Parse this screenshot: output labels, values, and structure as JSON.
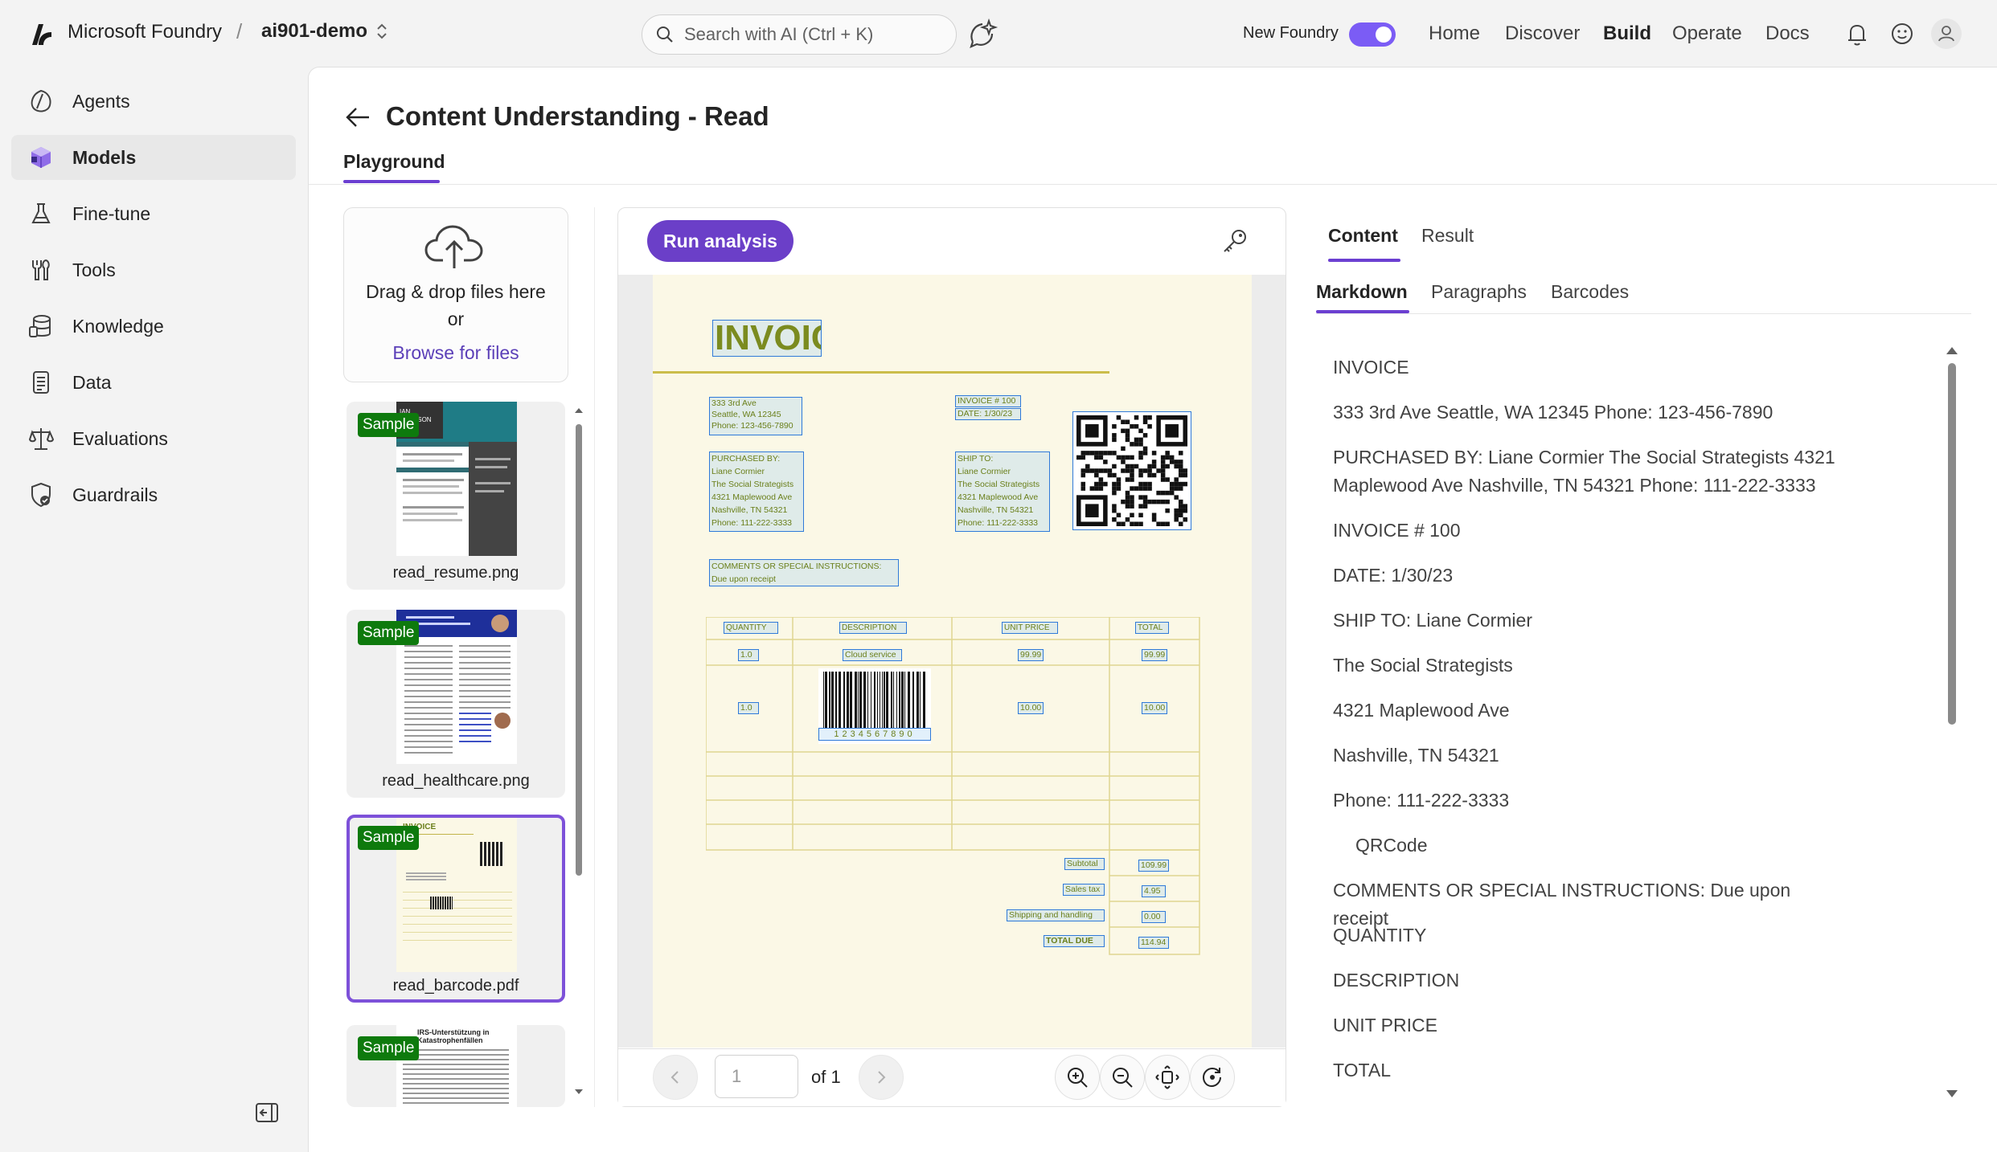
{
  "topbar": {
    "brand": "Microsoft Foundry",
    "separator": "/",
    "project": "ai901-demo",
    "search_placeholder": "Search with AI (Ctrl + K)",
    "new_foundry_label": "New Foundry",
    "nav": [
      "Home",
      "Discover",
      "Build",
      "Operate",
      "Docs"
    ],
    "active_nav": "Build",
    "accent": "#7b5cf5"
  },
  "sidebar": {
    "items": [
      {
        "label": "Agents",
        "icon": "agents-icon"
      },
      {
        "label": "Models",
        "icon": "models-icon",
        "active": true
      },
      {
        "label": "Fine-tune",
        "icon": "flask-icon"
      },
      {
        "label": "Tools",
        "icon": "tools-icon"
      },
      {
        "label": "Knowledge",
        "icon": "database-icon"
      },
      {
        "label": "Data",
        "icon": "document-icon"
      },
      {
        "label": "Evaluations",
        "icon": "scales-icon"
      },
      {
        "label": "Guardrails",
        "icon": "shield-icon"
      }
    ]
  },
  "page": {
    "title": "Content Understanding - Read",
    "tab": "Playground"
  },
  "upload": {
    "line1": "Drag & drop files here",
    "line2": "or",
    "link": "Browse for files"
  },
  "files": {
    "badge": "Sample",
    "items": [
      {
        "name": "read_resume.png",
        "selected": false
      },
      {
        "name": "read_healthcare.png",
        "selected": false
      },
      {
        "name": "read_barcode.pdf",
        "selected": true
      },
      {
        "name": "",
        "selected": false
      }
    ]
  },
  "thumbs": {
    "resume_name": "IAN\nHANSSON",
    "invoice_title": "INVOICE",
    "tax_title": "IRS-Unterstützung in Katastrophenfällen"
  },
  "viewer": {
    "run_button": "Run analysis",
    "page_value": "1",
    "of_label": "of 1"
  },
  "document": {
    "title": "INVOICE",
    "address": [
      "333 3rd Ave",
      "Seattle, WA 12345",
      "Phone: 123-456-7890"
    ],
    "invoice_meta": [
      "INVOICE # 100",
      "DATE: 1/30/23"
    ],
    "purchased_by": [
      "PURCHASED BY:",
      "Liane Cormier",
      "The Social Strategists",
      "4321 Maplewood Ave",
      "Nashville, TN 54321",
      "Phone: 111-222-3333"
    ],
    "ship_to": [
      "SHIP TO:",
      "Liane Cormier",
      "The Social Strategists",
      "4321 Maplewood Ave",
      "Nashville, TN 54321",
      "Phone: 111-222-3333"
    ],
    "comments": [
      "COMMENTS OR SPECIAL INSTRUCTIONS:",
      "Due upon receipt"
    ],
    "table_headers": [
      "QUANTITY",
      "DESCRIPTION",
      "UNIT PRICE",
      "TOTAL"
    ],
    "row1": [
      "1.0",
      "Cloud service",
      "99.99",
      "99.99"
    ],
    "row2": [
      "1.0",
      "",
      "10.00",
      "10.00"
    ],
    "barcode_digits": "1234567890",
    "totals_labels": [
      "Subtotal",
      "Sales tax",
      "Shipping and handling",
      "TOTAL DUE"
    ],
    "totals_values": [
      "109.99",
      "4.95",
      "0.00",
      "114.94"
    ]
  },
  "results": {
    "tabs": [
      "Content",
      "Result"
    ],
    "active_tab": "Content",
    "subtabs": [
      "Markdown",
      "Paragraphs",
      "Barcodes"
    ],
    "active_subtab": "Markdown",
    "markdown_lines": [
      "INVOICE",
      "333 3rd Ave Seattle, WA 12345 Phone: 123-456-7890",
      "PURCHASED BY: Liane Cormier The Social Strategists 4321 Maplewood Ave Nashville, TN 54321 Phone: 111-222-3333",
      "INVOICE # 100",
      "DATE: 1/30/23",
      "SHIP TO: Liane Cormier",
      "The Social Strategists",
      "4321 Maplewood Ave",
      "Nashville, TN 54321",
      "Phone: 111-222-3333",
      "QRCode",
      "COMMENTS OR SPECIAL INSTRUCTIONS: Due upon receipt",
      "QUANTITY",
      "DESCRIPTION",
      "UNIT PRICE",
      "TOTAL"
    ]
  }
}
